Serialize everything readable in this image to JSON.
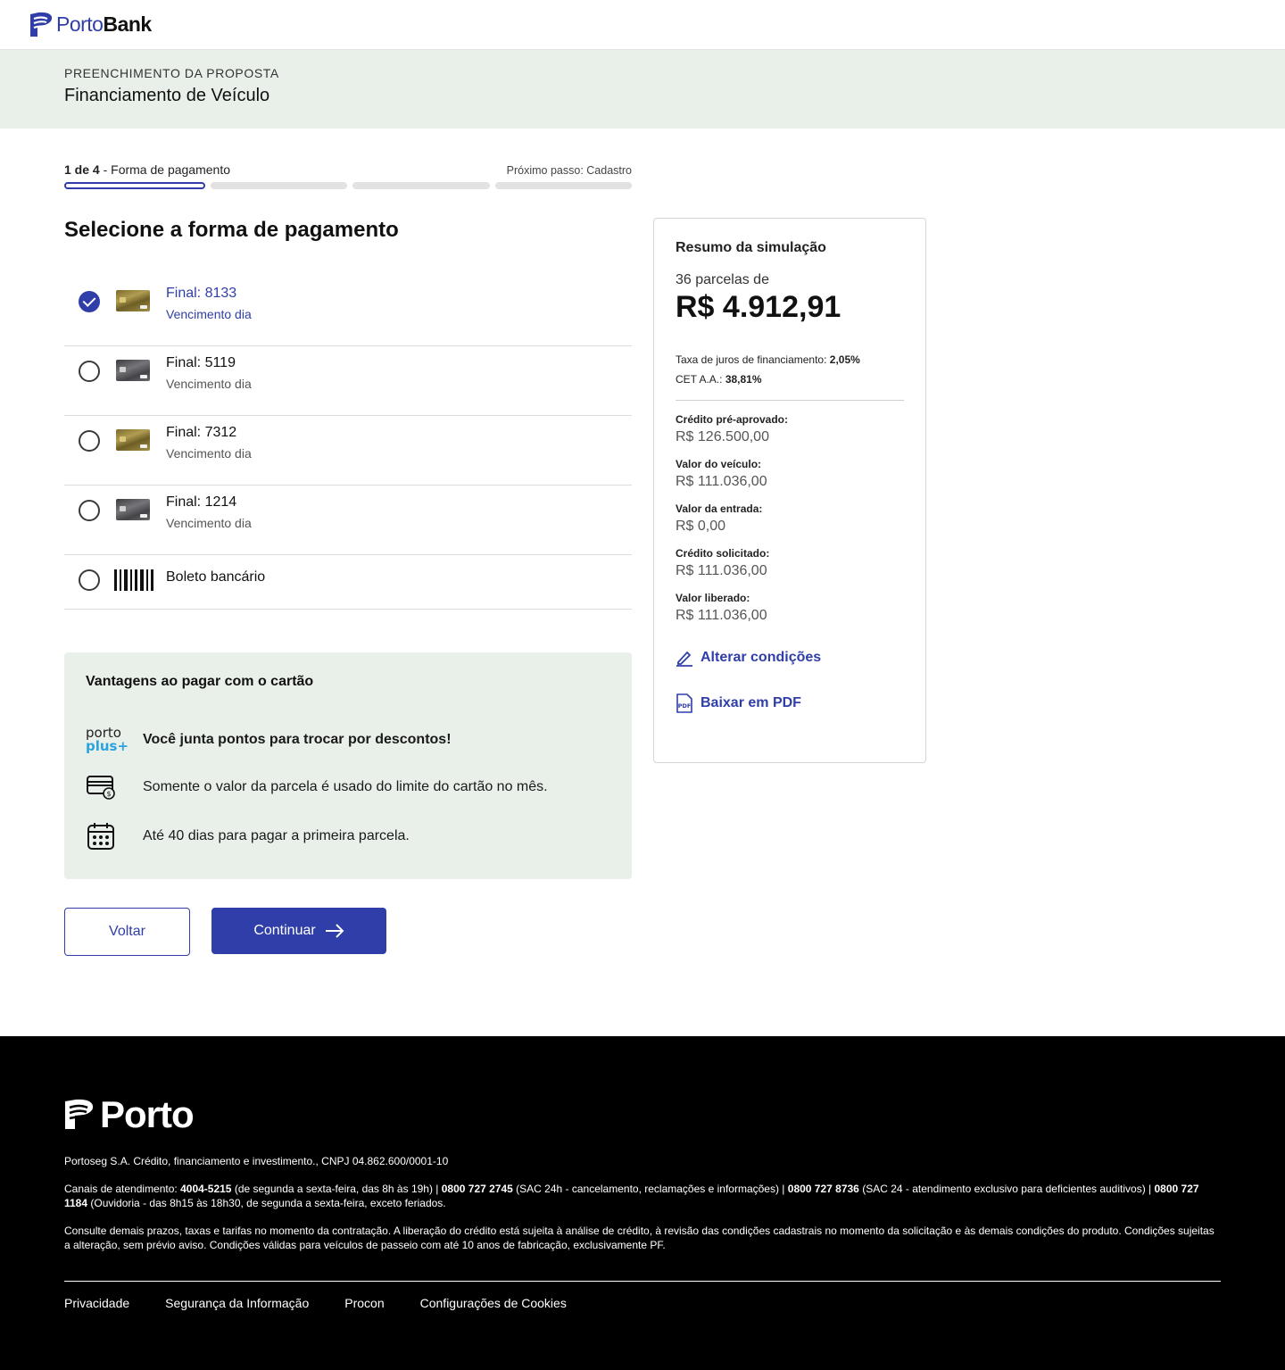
{
  "brand": {
    "porto": "Porto",
    "bank": "Bank"
  },
  "header": {
    "eyebrow": "PREENCHIMENTO DA PROPOSTA",
    "title": "Financiamento de Veículo"
  },
  "stepper": {
    "current": "1 de 4",
    "current_label": " - Forma de pagamento",
    "next": "Próximo passo: Cadastro",
    "total_steps": 4,
    "active_step": 1
  },
  "section_title": "Selecione a forma de pagamento",
  "payment_options": [
    {
      "title": "Final: 8133",
      "subtitle": "Vencimento dia",
      "card_style": "gold",
      "selected": true
    },
    {
      "title": "Final: 5119",
      "subtitle": "Vencimento dia",
      "card_style": "gray",
      "selected": false
    },
    {
      "title": "Final: 7312",
      "subtitle": "Vencimento dia",
      "card_style": "gold",
      "selected": false
    },
    {
      "title": "Final: 1214",
      "subtitle": "Vencimento dia",
      "card_style": "gray",
      "selected": false
    },
    {
      "title": "Boleto bancário",
      "icon": "barcode-icon",
      "selected": false
    }
  ],
  "advantages": {
    "title": "Vantagens ao pagar com o cartão",
    "porto_plus_logo": {
      "line1": "porto",
      "line2": "plus+"
    },
    "items": [
      {
        "icon": "porto-plus-logo",
        "text": "Você junta pontos para trocar por descontos!"
      },
      {
        "icon": "credit-card-icon",
        "text": "Somente o valor da parcela é usado do limite do cartão no mês."
      },
      {
        "icon": "calendar-icon",
        "text": "Até 40 dias para pagar a primeira parcela."
      }
    ]
  },
  "buttons": {
    "back": "Voltar",
    "continue": "Continuar"
  },
  "summary": {
    "title": "Resumo da simulação",
    "installments": "36 parcelas de",
    "amount": "R$ 4.912,91",
    "rate_label": "Taxa de juros de financiamento: ",
    "rate_value": "2,05%",
    "cet_label": "CET A.A.: ",
    "cet_value": "38,81%",
    "fields": [
      {
        "label": "Crédito pré-aprovado:",
        "value": "R$ 126.500,00"
      },
      {
        "label": "Valor do veículo:",
        "value": "R$ 111.036,00"
      },
      {
        "label": "Valor da entrada:",
        "value": "R$ 0,00"
      },
      {
        "label": "Crédito solicitado:",
        "value": "R$ 111.036,00"
      },
      {
        "label": "Valor liberado:",
        "value": "R$ 111.036,00"
      }
    ],
    "change_link": "Alterar condições",
    "pdf_link": "Baixar em PDF"
  },
  "footer": {
    "logo": "Porto",
    "company": "Portoseg S.A. Crédito, financiamento e investimento., CNPJ 04.862.600/0001-10",
    "channels_prefix": "Canais de atendimento: ",
    "phone1": "4004-5215",
    "phone1_desc": " (de segunda a sexta-feira, das 8h às 19h) | ",
    "phone2": "0800 727 2745",
    "phone2_desc": " (SAC 24h - cancelamento, reclamações e informações) | ",
    "phone3": "0800 727 8736",
    "phone3_desc": " (SAC 24 - atendimento exclusivo para deficientes auditivos) | ",
    "phone4": "0800 727 1184",
    "phone4_desc": " (Ouvidoria - das 8h15 às 18h30, de segunda a sexta-feira, exceto feriados.",
    "terms": "Consulte demais prazos, taxas e tarifas no momento da contratação. A liberação do crédito está sujeita à análise de crédito, à revisão das condições cadastrais no momento da solicitação e às demais condições do produto. Condições sujeitas a alteração, sem prévio aviso. Condições válidas para veículos de passeio com até 10 anos de fabricação, exclusivamente PF.",
    "links": [
      "Privacidade",
      "Segurança da Informação",
      "Procon",
      "Configurações de Cookies"
    ]
  },
  "colors": {
    "primary": "#2f3ea8",
    "band": "#e9f0ea",
    "footer_bg": "#000000",
    "accent_plus": "#2aa3e0"
  }
}
